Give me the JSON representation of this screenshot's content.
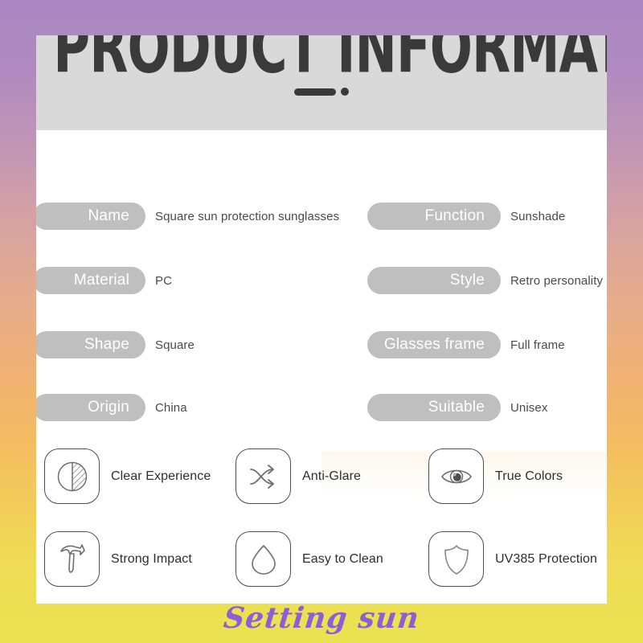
{
  "header": {
    "title": "PRODUCT INFORMATION",
    "underline_icon": "bar-dot-divider"
  },
  "specs": {
    "left_column": [
      {
        "label": "Name",
        "value": "Square sun protection sunglasses"
      },
      {
        "label": "Material",
        "value": "PC"
      },
      {
        "label": "Shape",
        "value": "Square"
      },
      {
        "label": "Origin",
        "value": "China"
      }
    ],
    "right_column": [
      {
        "label": "Function",
        "value": "Sunshade"
      },
      {
        "label": "Style",
        "value": "Retro personality"
      },
      {
        "label": "Glasses frame",
        "value": "Full frame"
      },
      {
        "label": "Suitable",
        "value": "Unisex"
      }
    ]
  },
  "features": [
    {
      "label": "Clear Experience",
      "icon": "half-hatched-circle-icon"
    },
    {
      "label": "Anti-Glare",
      "icon": "crossing-arrows-icon"
    },
    {
      "label": "True Colors",
      "icon": "eye-icon"
    },
    {
      "label": "Strong Impact",
      "icon": "hammer-icon"
    },
    {
      "label": "Easy to Clean",
      "icon": "water-drop-icon"
    },
    {
      "label": "UV385 Protection",
      "icon": "shield-icon"
    }
  ],
  "watermark": {
    "text": "Setting sun"
  },
  "colors": {
    "pill": "#bfbfbf",
    "header_band": "#d9d9d9",
    "title_text": "#3a3a3a",
    "card": "#ffffff",
    "watermark": "#8b5fd6",
    "gradient_top": "#ab88c2",
    "gradient_mid": "#f0b172",
    "gradient_bottom": "#eae34f"
  }
}
